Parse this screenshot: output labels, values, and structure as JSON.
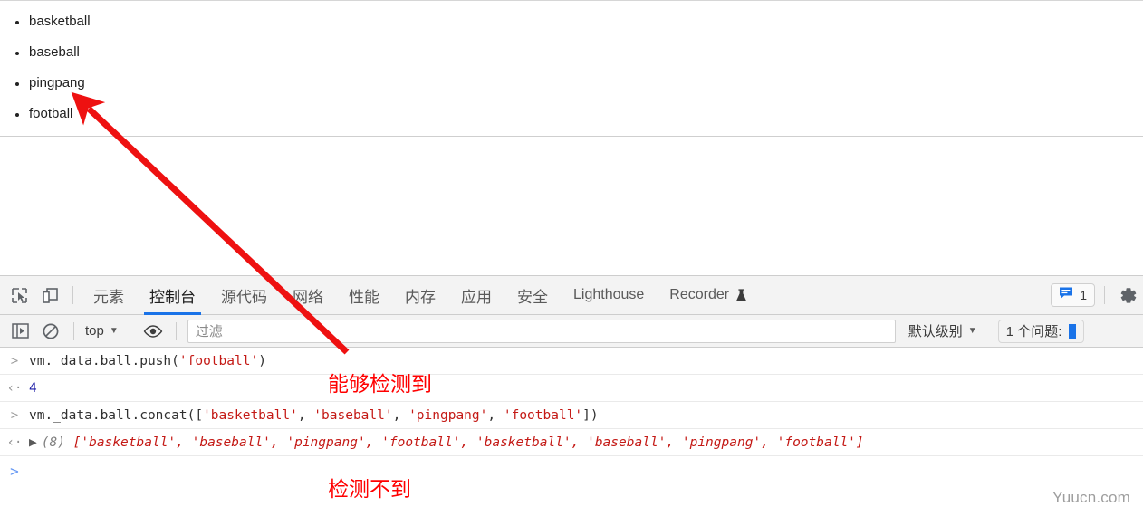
{
  "page": {
    "list_items": [
      "basketball",
      "baseball",
      "pingpang",
      "football"
    ]
  },
  "devtools": {
    "icons": {
      "inspect": "inspect-element-icon",
      "device": "device-toolbar-icon",
      "settings": "gear-icon",
      "issues": "issues-message-icon"
    },
    "tabs": [
      {
        "label": "元素",
        "active": false
      },
      {
        "label": "控制台",
        "active": true
      },
      {
        "label": "源代码",
        "active": false
      },
      {
        "label": "网络",
        "active": false
      },
      {
        "label": "性能",
        "active": false
      },
      {
        "label": "内存",
        "active": false
      },
      {
        "label": "应用",
        "active": false
      },
      {
        "label": "安全",
        "active": false
      },
      {
        "label": "Lighthouse",
        "active": false
      },
      {
        "label": "Recorder",
        "active": false,
        "icon": "flask-icon"
      }
    ],
    "issues_badge_count": "1",
    "console_toolbar": {
      "clear_icon": "no-entry-clear-console-icon",
      "sidebar_icon": "console-sidebar-icon",
      "eye_icon": "eye-live-expression-icon",
      "context_label": "top",
      "filter_placeholder": "过滤",
      "filter_value": "",
      "level_label": "默认级别",
      "issues_label": "1 个问题:"
    },
    "messages": [
      {
        "type": "input",
        "gutter": ">",
        "parts": [
          {
            "t": "vm._data.ball.push(",
            "c": "pun"
          },
          {
            "t": "'football'",
            "c": "str"
          },
          {
            "t": ")",
            "c": "pun"
          }
        ]
      },
      {
        "type": "output",
        "gutter": "<",
        "parts": [
          {
            "t": "4",
            "c": "num"
          }
        ]
      },
      {
        "type": "input",
        "gutter": ">",
        "parts": [
          {
            "t": "vm._data.ball.concat([",
            "c": "pun"
          },
          {
            "t": "'basketball'",
            "c": "str"
          },
          {
            "t": ", ",
            "c": "pun"
          },
          {
            "t": "'baseball'",
            "c": "str"
          },
          {
            "t": ", ",
            "c": "pun"
          },
          {
            "t": "'pingpang'",
            "c": "str"
          },
          {
            "t": ", ",
            "c": "pun"
          },
          {
            "t": "'football'",
            "c": "str"
          },
          {
            "t": "])",
            "c": "pun"
          }
        ]
      },
      {
        "type": "output",
        "gutter": "<",
        "expandable": true,
        "parts": [
          {
            "t": "(8)",
            "c": "grey"
          },
          {
            "t": " [",
            "c": "str"
          },
          {
            "t": "'basketball'",
            "c": "str"
          },
          {
            "t": ", ",
            "c": "str"
          },
          {
            "t": "'baseball'",
            "c": "str"
          },
          {
            "t": ", ",
            "c": "str"
          },
          {
            "t": "'pingpang'",
            "c": "str"
          },
          {
            "t": ", ",
            "c": "str"
          },
          {
            "t": "'football'",
            "c": "str"
          },
          {
            "t": ", ",
            "c": "str"
          },
          {
            "t": "'basketball'",
            "c": "str"
          },
          {
            "t": ", ",
            "c": "str"
          },
          {
            "t": "'baseball'",
            "c": "str"
          },
          {
            "t": ", ",
            "c": "str"
          },
          {
            "t": "'pingpang'",
            "c": "str"
          },
          {
            "t": ", ",
            "c": "str"
          },
          {
            "t": "'football'",
            "c": "str"
          },
          {
            "t": "]",
            "c": "str"
          }
        ]
      }
    ],
    "prompt_gutter": ">"
  },
  "annotations": {
    "label_detected": "能够检测到",
    "label_not_detected": "检测不到",
    "arrow_color": "#ee1111"
  },
  "watermark": "Yuucn.com"
}
